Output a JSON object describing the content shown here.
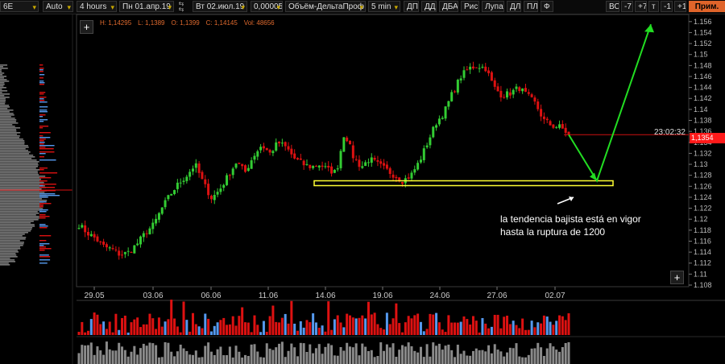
{
  "toolbar": {
    "symbol": "6E",
    "scale_mode": "Auto",
    "timeframe": "4 hours",
    "date_from": "Пн 01.апр.19",
    "date_to": "Вт 02.июл.19",
    "tick_size": "0,00005",
    "profile_type": "Объём-ДельтаПроф",
    "profile_period": "5 min",
    "btn_dp": "ДП",
    "btn_dd": "ДД",
    "btn_dba": "ДБА",
    "btn_draw": "Рис.",
    "btn_loupe": "Лупа",
    "btn_dl": "ДЛ",
    "btn_pl": "ПЛ",
    "btn_f": "Ф",
    "btn_vs": "ВС",
    "btn_m7": "-7",
    "btn_p7": "+7",
    "btn_t": "т",
    "btn_m1": "-1",
    "btn_p1": "+1",
    "btn_apply": "Прим."
  },
  "ohlc": {
    "high": "H: 1,14295",
    "low": "L: 1,1389",
    "open": "O: 1,1399",
    "close": "C: 1,14145",
    "volume": "Vol: 48656"
  },
  "annotation": {
    "line1": "la tendencia bajista está en vigor",
    "line2": "hasta la ruptura de 1200"
  },
  "current": {
    "price_label": "1,1354",
    "time_label": "23:02:32"
  },
  "plus_label": "+",
  "colors": {
    "bull": "#33cc33",
    "bear": "#dd1111",
    "zone": "#ffff33",
    "arrow": "#22dd22",
    "price_line": "#cc1111",
    "vol_red": "#dd1111",
    "vol_blue": "#5599ee"
  },
  "chart_data": {
    "type": "candlestick",
    "x_ticks": [
      "29.05",
      "03.06",
      "06.06",
      "11.06",
      "14.06",
      "19.06",
      "24.06",
      "27.06",
      "02.07"
    ],
    "y_ticks": [
      "1.108",
      "1.11",
      "1.112",
      "1.114",
      "1.116",
      "1.118",
      "1.12",
      "1.122",
      "1.124",
      "1.126",
      "1.128",
      "1.13",
      "1.132",
      "1.134",
      "1.136",
      "1.138",
      "1.14",
      "1.142",
      "1.144",
      "1.146",
      "1.148",
      "1.15",
      "1.152",
      "1.154",
      "1.156"
    ],
    "ylim": [
      1.108,
      1.157
    ],
    "close_path": [
      1.119,
      1.1175,
      1.1165,
      1.115,
      1.1145,
      1.1135,
      1.114,
      1.1155,
      1.1175,
      1.119,
      1.122,
      1.1245,
      1.1265,
      1.128,
      1.13,
      1.1265,
      1.1238,
      1.1255,
      1.128,
      1.1305,
      1.1285,
      1.1315,
      1.1335,
      1.132,
      1.134,
      1.133,
      1.131,
      1.13,
      1.1295,
      1.13,
      1.129,
      1.1285,
      1.136,
      1.1315,
      1.1295,
      1.131,
      1.13,
      1.129,
      1.128,
      1.127,
      1.128,
      1.1305,
      1.134,
      1.1375,
      1.1395,
      1.143,
      1.146,
      1.1475,
      1.148,
      1.1475,
      1.144,
      1.1425,
      1.143,
      1.144,
      1.1425,
      1.141,
      1.138,
      1.137,
      1.1368,
      1.1354
    ],
    "zone": {
      "from": 1.1262,
      "to": 1.127
    },
    "current_price": 1.1354,
    "projection": [
      {
        "x": "02.07",
        "y": 1.1354
      },
      {
        "x": "after 02.07",
        "y": 1.127
      },
      {
        "x": "after 02.07",
        "y": 1.1555
      }
    ]
  }
}
